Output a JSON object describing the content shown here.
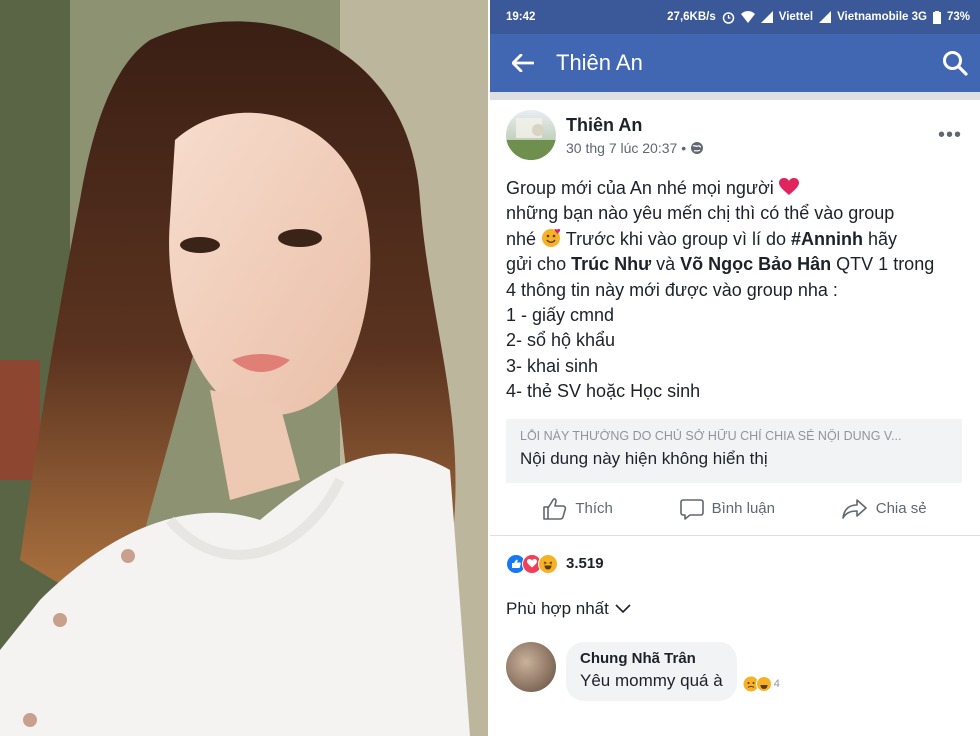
{
  "status_bar": {
    "time": "19:42",
    "network_speed": "27,6KB/s",
    "carrier1": "Viettel",
    "carrier2": "Vietnamobile 3G",
    "battery": "73%"
  },
  "app_bar": {
    "title": "Thiên An"
  },
  "post": {
    "author": "Thiên An",
    "timestamp": "30 thg 7 lúc 20:37 •",
    "line1": "Group mới của An nhé mọi người",
    "line2": "những bạn nào yêu mến chị thì có thể vào group",
    "line3_a": "nhé",
    "line3_b": " Trước khi vào group vì lí do ",
    "line3_hashtag": "#Anninh",
    "line3_c": "  hãy",
    "line4_a": "gửi cho ",
    "line4_name1": "Trúc Như",
    "line4_b": " và ",
    "line4_name2": "Võ Ngọc Bảo Hân",
    "line4_c": " QTV 1 trong",
    "line5": "4 thông tin này mới được vào group nha :",
    "line6": "1 - giấy cmnd",
    "line7": "2- sổ hộ khẩu",
    "line8": "3- khai sinh",
    "line9": "4- thẻ SV hoặc Học sinh",
    "shared_notice_small": "LỖI NÀY THƯỜNG DO CHỦ SỞ HỮU CHỈ CHIA SẺ NỘI DUNG V...",
    "shared_notice": "Nội dung này hiện không hiển thị"
  },
  "actions": {
    "like": "Thích",
    "comment": "Bình luận",
    "share": "Chia sẻ"
  },
  "reactions": {
    "count": "3.519"
  },
  "sort": {
    "label": "Phù hợp nhất"
  },
  "comment": {
    "name": "Chung Nhã Trân",
    "text": "Yêu mommy quá à",
    "reaction_count": "4"
  },
  "colors": {
    "brand_dark": "#3b5998",
    "brand": "#4267b2",
    "like_blue": "#1877f2",
    "love_red": "#f33e58",
    "haha_yellow": "#f7b125"
  }
}
